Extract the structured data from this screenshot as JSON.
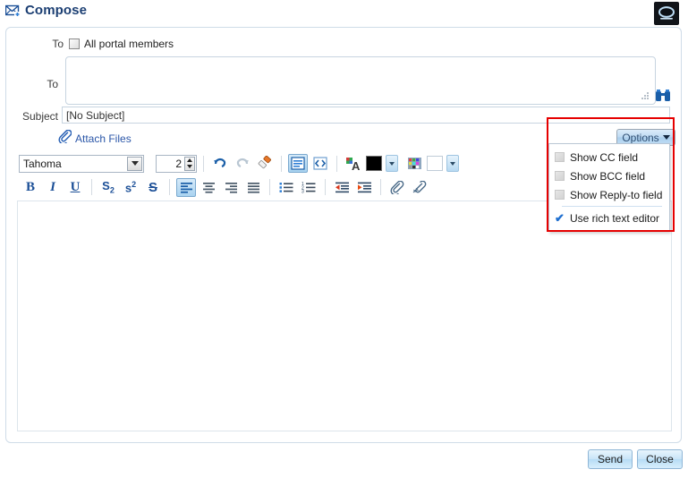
{
  "header": {
    "title": "Compose",
    "title_icon": "envelope-add-icon",
    "logo_icon": "portal-logo-icon"
  },
  "form": {
    "all_members_label": "To",
    "all_members_checkbox_label": "All portal members",
    "all_members_checked": false,
    "to_label": "To",
    "to_value": "",
    "to_placeholder": "",
    "address_book_icon": "binoculars-icon",
    "resize_grip_icon": "resize-grip-icon",
    "subject_label": "Subject",
    "subject_value": "[No Subject]",
    "attach_label": "Attach Files",
    "attach_icon": "paperclip-icon",
    "options_button_label": "Options",
    "options_caret_icon": "caret-down-icon"
  },
  "options_menu": {
    "items": [
      {
        "label": "Show CC field",
        "marker": "checkbox-unchecked-icon",
        "checked": false
      },
      {
        "label": "Show BCC field",
        "marker": "checkbox-unchecked-icon",
        "checked": false
      },
      {
        "label": "Show Reply-to field",
        "marker": "checkbox-unchecked-icon",
        "checked": false
      },
      {
        "label": "Use rich text editor",
        "marker": "check-icon",
        "checked": true
      }
    ],
    "check_glyph": "✔",
    "highlight_color": "#e60000"
  },
  "editor": {
    "font_family_value": "Tahoma",
    "font_size_value": "2",
    "body_value": "",
    "toolbar_row1": [
      {
        "name": "font-family-select",
        "label": "Tahoma"
      },
      {
        "name": "font-size-stepper",
        "label": "2"
      },
      {
        "name": "undo-icon",
        "label": "Undo"
      },
      {
        "name": "redo-icon",
        "label": "Redo"
      },
      {
        "name": "remove-format-icon",
        "label": "Remove formatting"
      },
      {
        "name": "toggle-editor-icon",
        "label": "Toggle editor"
      },
      {
        "name": "source-code-icon",
        "label": "Source"
      },
      {
        "name": "text-color-picker-icon",
        "label": "Text color"
      },
      {
        "name": "text-color-swatch",
        "label": "Text color swatch"
      },
      {
        "name": "background-color-picker-icon",
        "label": "Background color"
      },
      {
        "name": "background-color-swatch",
        "label": "Background color swatch"
      }
    ],
    "toolbar_row2": [
      {
        "name": "bold-icon",
        "label": "B"
      },
      {
        "name": "italic-icon",
        "label": "I"
      },
      {
        "name": "underline-icon",
        "label": "U"
      },
      {
        "name": "subscript-icon",
        "label": "S"
      },
      {
        "name": "superscript-icon",
        "label": "S"
      },
      {
        "name": "strikethrough-icon",
        "label": "S"
      },
      {
        "name": "align-left-icon",
        "label": "Align left",
        "active": true
      },
      {
        "name": "align-center-icon",
        "label": "Align center"
      },
      {
        "name": "align-right-icon",
        "label": "Align right"
      },
      {
        "name": "align-justify-icon",
        "label": "Justify"
      },
      {
        "name": "bullet-list-icon",
        "label": "Bulleted list"
      },
      {
        "name": "numbered-list-icon",
        "label": "Numbered list"
      },
      {
        "name": "outdent-icon",
        "label": "Outdent"
      },
      {
        "name": "indent-icon",
        "label": "Indent"
      },
      {
        "name": "insert-link-icon",
        "label": "Insert link"
      },
      {
        "name": "remove-link-icon",
        "label": "Remove link"
      }
    ]
  },
  "footer": {
    "send_label": "Send",
    "close_label": "Close"
  },
  "colors": {
    "title": "#1c3f73",
    "link": "#2a56a8",
    "panel_border": "#cfdce8",
    "button_blue": "#b6dcf5",
    "highlight_red": "#e60000",
    "text_color_swatch": "#000000",
    "background_color_swatch": "#ffffff"
  }
}
